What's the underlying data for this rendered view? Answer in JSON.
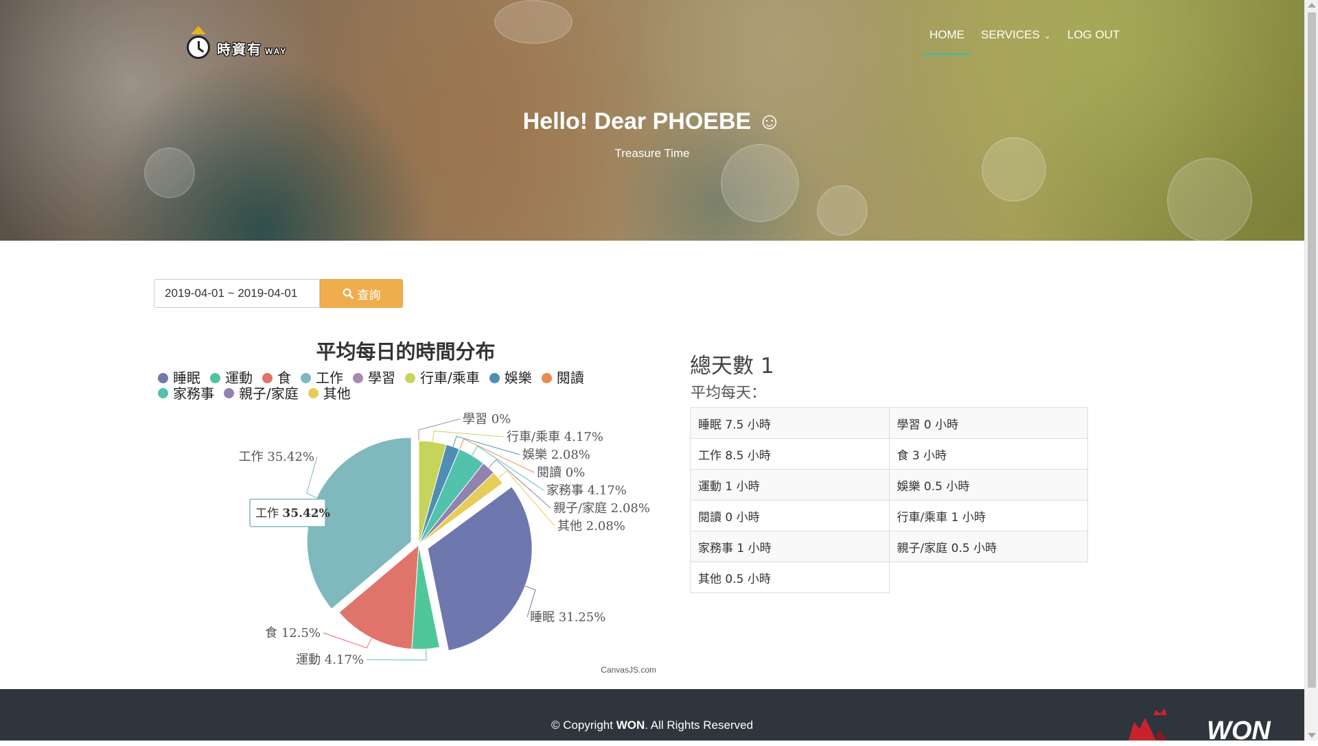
{
  "brand": {
    "logo_text": "時資有",
    "logo_sub": "WAY"
  },
  "nav": {
    "home": "HOME",
    "services": "SERVICES",
    "logout": "LOG OUT"
  },
  "hero": {
    "title": "Hello! Dear PHOEBE ☺",
    "subtitle": "Treasure Time"
  },
  "query": {
    "date_range": "2019-04-01 ~ 2019-04-01",
    "button_label": "查詢",
    "button_icon": "search-icon"
  },
  "chart_data": {
    "type": "pie",
    "title": "平均每日的時間分布",
    "legend_placement": "top",
    "slices": [
      {
        "label": "睡眠",
        "value": 31.25,
        "display": "31.25%",
        "color": "#6e78ae"
      },
      {
        "label": "運動",
        "value": 4.17,
        "display": "4.17%",
        "color": "#4fc79a"
      },
      {
        "label": "食",
        "value": 12.5,
        "display": "12.5%",
        "color": "#e0746a"
      },
      {
        "label": "工作",
        "value": 35.42,
        "display": "35.42%",
        "color": "#7fb8bd"
      },
      {
        "label": "學習",
        "value": 0,
        "display": "0%",
        "color": "#a889b0"
      },
      {
        "label": "行車/乘車",
        "value": 4.17,
        "display": "4.17%",
        "color": "#c6d45a"
      },
      {
        "label": "娛樂",
        "value": 2.08,
        "display": "2.08%",
        "color": "#4f8db4"
      },
      {
        "label": "閱讀",
        "value": 0,
        "display": "0%",
        "color": "#e88a54"
      },
      {
        "label": "家務事",
        "value": 4.17,
        "display": "4.17%",
        "color": "#52c2ad"
      },
      {
        "label": "親子/家庭",
        "value": 2.08,
        "display": "2.08%",
        "color": "#9182af"
      },
      {
        "label": "其他",
        "value": 2.08,
        "display": "2.08%",
        "color": "#e6cd5a"
      }
    ],
    "tooltip": {
      "label": "工作",
      "value": "35.42%"
    },
    "credit": "CanvasJS.com"
  },
  "stats": {
    "total_label": "總天數 1",
    "avg_label": "平均每天：",
    "rows": [
      [
        "睡眠 7.5 小時",
        "學習 0 小時"
      ],
      [
        "工作 8.5 小時",
        "食 3 小時"
      ],
      [
        "運動 1 小時",
        "娛樂 0.5 小時"
      ],
      [
        "閱讀 0 小時",
        "行車/乘車 1 小時"
      ],
      [
        "家務事 1 小時",
        "親子/家庭 0.5 小時"
      ],
      [
        "其他 0.5 小時",
        ""
      ]
    ]
  },
  "footer": {
    "copyright_prefix": "© Copyright ",
    "copyright_brand": "WON",
    "copyright_suffix": ". All Rights Reserved",
    "logo_text": "WON"
  }
}
